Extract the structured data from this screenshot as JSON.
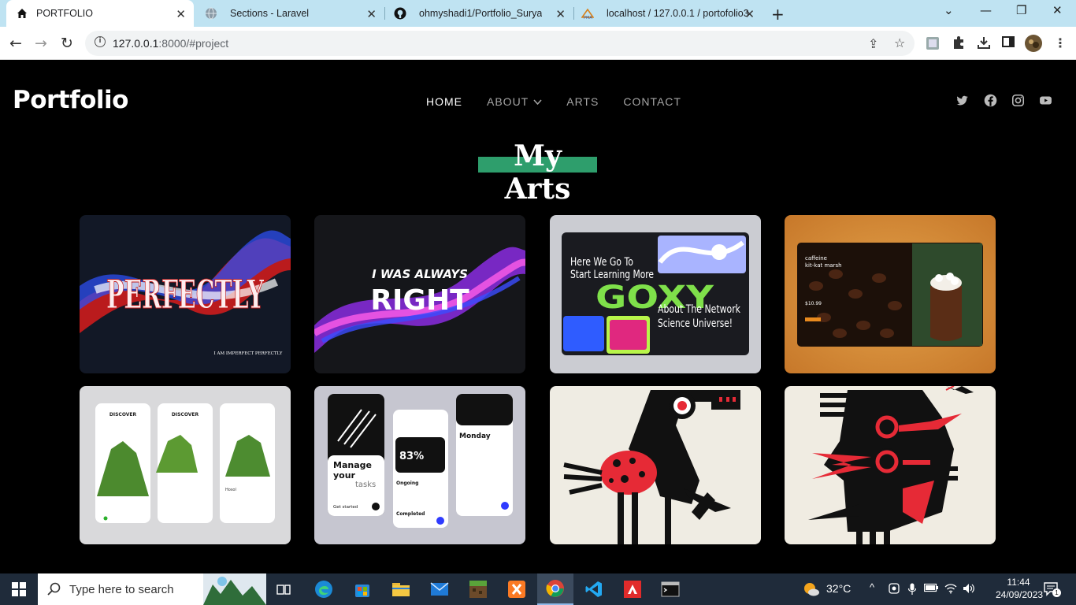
{
  "browser": {
    "tabs": [
      {
        "title": "PORTFOLIO",
        "icon": "home-icon",
        "active": true
      },
      {
        "title": "Sections - Laravel",
        "icon": "globe-icon",
        "active": false
      },
      {
        "title": "ohmyshadi1/Portfolio_Surya",
        "icon": "github-icon",
        "active": false
      },
      {
        "title": "localhost / 127.0.0.1 / portofolio3",
        "icon": "phpmyadmin-icon",
        "active": false
      }
    ],
    "url_host": "127.0.0.1",
    "url_rest": ":8000/#project"
  },
  "site": {
    "logo": "Portfolio",
    "nav": [
      "HOME",
      "ABOUT",
      "ARTS",
      "CONTACT"
    ],
    "heading": "My Arts",
    "social": [
      "twitter-icon",
      "facebook-icon",
      "instagram-icon",
      "youtube-icon"
    ],
    "arts": [
      {
        "name": "perfectly-artwork",
        "text": "PERFECTLY",
        "caption": "I AM IMPERFECT PERFECTLY"
      },
      {
        "name": "i-was-always-right-artwork",
        "text1": "I WAS ALWAYS",
        "text2": "RIGHT"
      },
      {
        "name": "goxy-web-design",
        "t1": "Here We Go To",
        "t2": "Start Learning More",
        "t3": "GOXY",
        "t4": "About The Network",
        "t5": "Science Universe!"
      },
      {
        "name": "coffee-shop-design",
        "t1": "caffeine",
        "t2": "kit-kat marsh",
        "t3": "$10.99"
      },
      {
        "name": "discover-app-design",
        "t1": "DISCOVER",
        "t2": "DISCOVER",
        "t3": "Hosol"
      },
      {
        "name": "task-manager-app-design",
        "t1": "Manage",
        "t2": "your",
        "t3": "tasks",
        "t4": "Get started",
        "t5": "83%",
        "t6": "Monday",
        "t7": "Ongoing",
        "t8": "Completed"
      },
      {
        "name": "abstract-bird-artwork"
      },
      {
        "name": "abstract-face-artwork"
      }
    ]
  },
  "taskbar": {
    "search_placeholder": "Type here to search",
    "weather": "32°C",
    "time": "11:44",
    "date": "24/09/2023",
    "notifications": "1"
  }
}
